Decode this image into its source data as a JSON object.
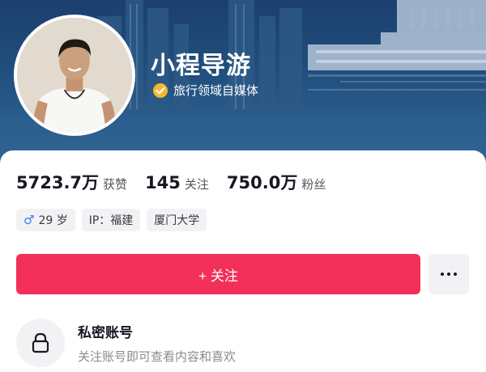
{
  "profile": {
    "display_name": "小程导游",
    "verification": "旅行领域自媒体"
  },
  "stats": [
    {
      "value": "5723.7万",
      "label": "获赞"
    },
    {
      "value": "145",
      "label": "关注"
    },
    {
      "value": "750.0万",
      "label": "粉丝"
    }
  ],
  "tags": {
    "age": "29 岁",
    "ip": "IP：福建",
    "school": "厦门大学"
  },
  "actions": {
    "follow_label": "+ 关注"
  },
  "private_account": {
    "title": "私密账号",
    "description": "关注账号即可查看内容和喜欢"
  },
  "colors": {
    "accent": "#f2305a",
    "verify_badge": "#f5b731",
    "gender_male": "#3a7ef0"
  },
  "icons": {
    "verify": "verified-badge-icon",
    "gender": "male-icon",
    "more": "more-dots-icon",
    "lock": "lock-icon"
  }
}
